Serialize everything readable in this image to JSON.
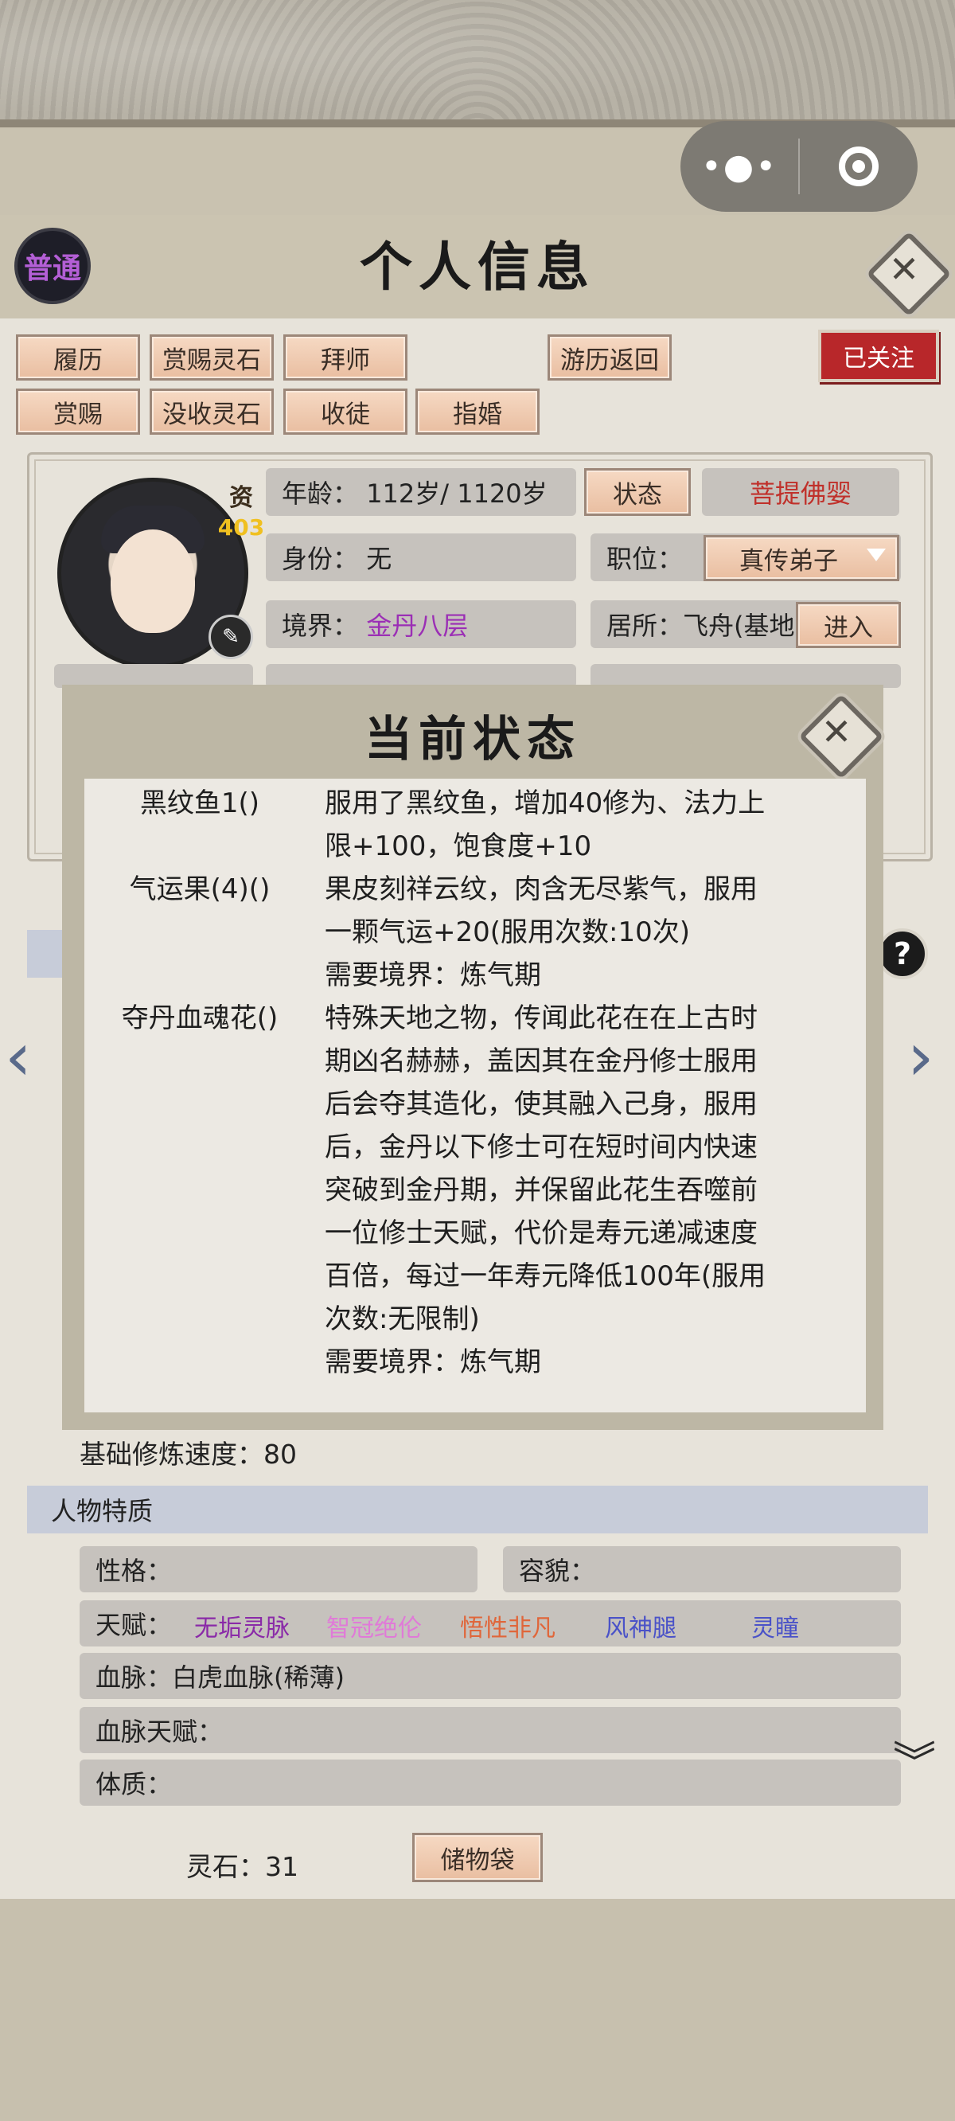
{
  "capsule": {
    "more_icon": "more-dots-icon",
    "close_icon": "target-ring-icon"
  },
  "header": {
    "title": "个人信息",
    "mode_badge": "普通",
    "close_label": "✕"
  },
  "actions": {
    "row1": [
      "履历",
      "赏赐灵石",
      "拜师",
      "游历返回"
    ],
    "row2": [
      "赏赐",
      "没收灵石",
      "收徒",
      "指婚"
    ],
    "followed": "已关注"
  },
  "profile": {
    "aptitude_label": "资",
    "aptitude_value": "403",
    "age_label": "年龄：",
    "age_value": "112岁/ 1120岁",
    "status_button": "状态",
    "special": "菩提佛婴",
    "identity_label": "身份：",
    "identity_value": "无",
    "position_label": "职位：",
    "position_value": "真传弟子",
    "realm_label": "境界：",
    "realm_value": "金丹八层",
    "residence_label": "居所：",
    "residence_value": "飞舟(基地",
    "enter_button": "进入"
  },
  "modal": {
    "title": "当前状态",
    "items": [
      {
        "name": "黑纹鱼1()",
        "desc": [
          "服用了黑纹鱼，增加40修为、法力上",
          "限+100，饱食度+10"
        ]
      },
      {
        "name": "气运果(4)()",
        "desc": [
          "果皮刻祥云纹，肉含无尽紫气，服用",
          "一颗气运+20(服用次数:10次)",
          "需要境界：炼气期"
        ]
      },
      {
        "name": "夺丹血魂花()",
        "desc": [
          "特殊天地之物，传闻此花在在上古时",
          "期凶名赫赫，盖因其在金丹修士服用",
          "后会夺其造化，使其融入己身，服用",
          "后，金丹以下修士可在短时间内快速",
          "突破到金丹期，并保留此花生吞噬前",
          "一位修士天赋，代价是寿元递减速度",
          "百倍，每过一年寿元降低100年(服用",
          "次数:无限制)",
          "需要境界：炼气期"
        ]
      }
    ]
  },
  "cultivation": {
    "speed_label": "基础修炼速度：",
    "speed_value": "80"
  },
  "traits": {
    "section_title": "人物特质",
    "personality_label": "性格：",
    "appearance_label": "容貌：",
    "talent_label": "天赋：",
    "talents": [
      {
        "text": "无垢灵脉",
        "color": "#8a2aa8"
      },
      {
        "text": "智冠绝伦",
        "color": "#e07ad8"
      },
      {
        "text": "悟性非凡",
        "color": "#e0663a"
      },
      {
        "text": "风神腿",
        "color": "#4a52c8"
      },
      {
        "text": "灵瞳",
        "color": "#4a52c8"
      }
    ],
    "bloodline_label": "血脉：",
    "bloodline_value": "白虎血脉(稀薄)",
    "bloodline_talent_label": "血脉天赋：",
    "physique_label": "体质："
  },
  "footer": {
    "spirit_stone_label": "灵石：",
    "spirit_stone_value": "31",
    "bag_button": "储物袋"
  }
}
